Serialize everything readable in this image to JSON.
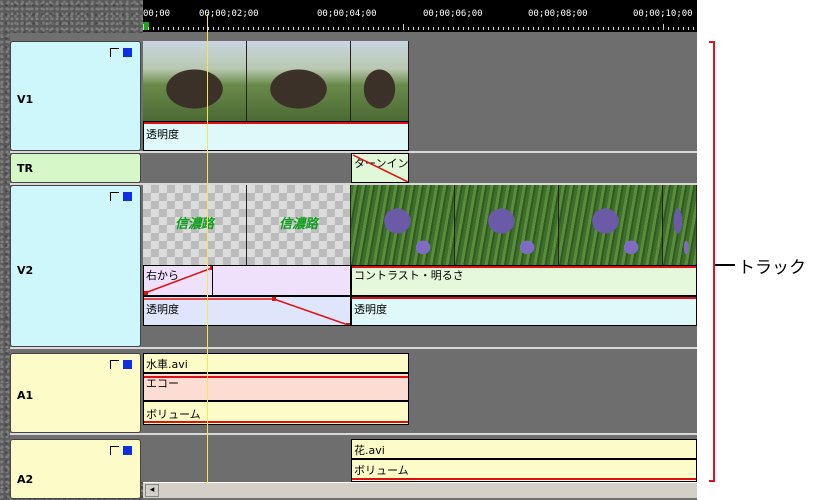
{
  "ruler": {
    "timecodes": [
      "00;00",
      "00;00;02;00",
      "00;00;04;00",
      "00;00;06;00",
      "00;00;08;00",
      "00;00;10;00"
    ]
  },
  "tracks": {
    "v1": {
      "name": "V1",
      "clip_label": "透明度"
    },
    "tr": {
      "name": "TR",
      "transition_label": "ターンイン"
    },
    "v2": {
      "name": "V2",
      "title_text": "信濃路",
      "wipe_label": "右から",
      "opacity_label": "透明度",
      "contrast_label": "コントラスト・明るさ",
      "opacity_label_2": "透明度"
    },
    "a1": {
      "name": "A1",
      "clip_name": "水車.avi",
      "effect_label": "エコー",
      "volume_label": "ボリューム"
    },
    "a2": {
      "name": "A2",
      "clip_name": "花.avi",
      "volume_label": "ボリューム"
    }
  },
  "scrollbar": {
    "left_arrow": "◂"
  },
  "annotation": {
    "label": "トラック",
    "color": "#e01020"
  },
  "colors": {
    "v_header": "#cdf7fb",
    "tr_header": "#d6f7c7",
    "a_header": "#fdfbc8",
    "playhead": "#f4e84a",
    "rubberband": "#e01010"
  }
}
